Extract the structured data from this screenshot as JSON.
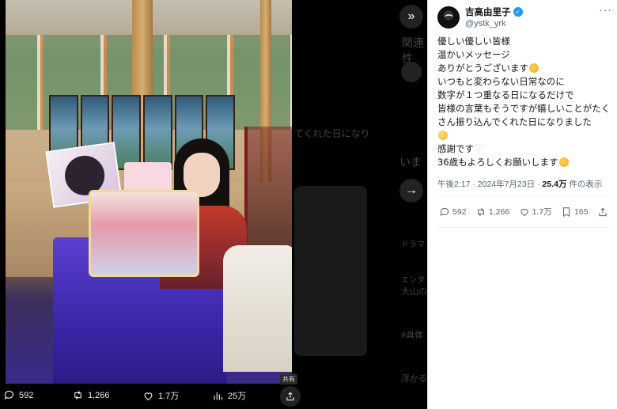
{
  "viewer": {
    "share_tooltip": "共有",
    "actions": {
      "replies": "592",
      "reposts": "1,266",
      "likes": "1.7万",
      "views": "25万"
    }
  },
  "background_page": {
    "heading": "関連性",
    "snippet_1": "てくれた日になり",
    "snippet_2": "いま",
    "trend_1_category": "ドラマ",
    "trend_2_category": "エンタ",
    "trend_2_title": "大山の",
    "trend_3_title": "#具体",
    "trend_4_title": "浮かる"
  },
  "tweet": {
    "author_name": "吉高由里子",
    "author_handle": "@ystk_yrk",
    "verified": true,
    "lines": [
      "優しい優しい皆様",
      "温かいメッセージ",
      "ありがとうございます",
      "いつもと変わらない日常なのに",
      "数字が１つ重なる日になるだけで",
      "皆様の言葉もそうですが嬉しいことがたくさん振り込んでくれた日になりました",
      "感謝です",
      "36歳もよろしくお願いします"
    ],
    "time": "午後2:17",
    "date": "2024年7月23日",
    "views_count": "25.4万",
    "views_label": "件の表示",
    "stats": {
      "replies": "592",
      "reposts": "1,266",
      "likes": "1.7万",
      "bookmarks": "165"
    }
  },
  "colors": {
    "verified": "#1d9bf0",
    "text_primary": "#0f1419",
    "text_secondary": "#536471"
  }
}
